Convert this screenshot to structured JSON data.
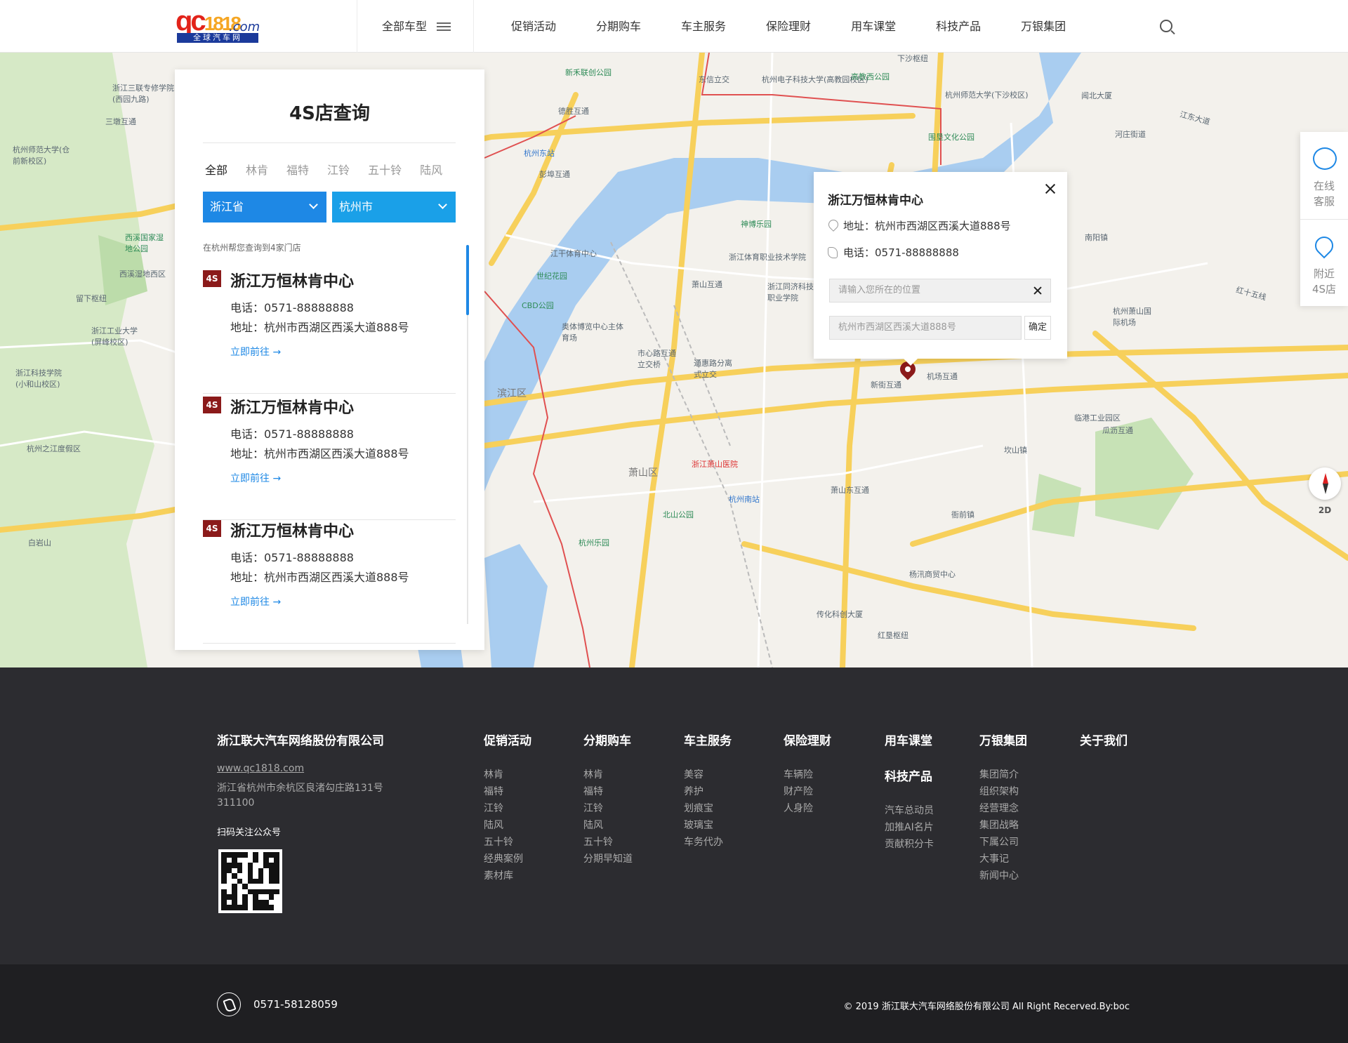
{
  "header": {
    "logo_main": "qc",
    "logo_nums": "1818",
    "logo_com": ".com",
    "logo_sub": "全球汽车网",
    "all_models": "全部车型",
    "nav": [
      "促销活动",
      "分期购车",
      "车主服务",
      "保险理财",
      "用车课堂",
      "科技产品",
      "万银集团"
    ]
  },
  "panel": {
    "title": "4S店查询",
    "brands": [
      "全部",
      "林肯",
      "福特",
      "江铃",
      "五十铃",
      "陆风"
    ],
    "province": "浙江省",
    "city": "杭州市",
    "result_hint": "在杭州帮您查询到4家门店",
    "stores": [
      {
        "badge": "4S",
        "name": "浙江万恒林肯中心",
        "phone": "电话：0571-88888888",
        "address": "地址：杭州市西湖区西溪大道888号",
        "link": "立即前往 →"
      },
      {
        "badge": "4S",
        "name": "浙江万恒林肯中心",
        "phone": "电话：0571-88888888",
        "address": "地址：杭州市西湖区西溪大道888号",
        "link": "立即前往 →"
      },
      {
        "badge": "4S",
        "name": "浙江万恒林肯中心",
        "phone": "电话：0571-88888888",
        "address": "地址：杭州市西湖区西溪大道888号",
        "link": "立即前往 →"
      }
    ]
  },
  "popup": {
    "title": "浙江万恒林肯中心",
    "address": "地址：杭州市西湖区西溪大道888号",
    "phone": "电话：0571-88888888",
    "location_placeholder": "请输入您所在的位置",
    "destination": "杭州市西湖区西溪大道888号",
    "confirm": "确定"
  },
  "side_tools": {
    "service_line1": "在线",
    "service_line2": "客服",
    "nearby_line1": "附近",
    "nearby_line2": "4S店",
    "map_mode": "2D"
  },
  "map_labels": [
    {
      "text": "新禾联创公园",
      "cls": "green"
    },
    {
      "text": "东信立交",
      "cls": ""
    },
    {
      "text": "杭州电子科技大学(高教园校区)",
      "cls": ""
    },
    {
      "text": "高教西公园",
      "cls": "green"
    },
    {
      "text": "杭州师范大学(下沙校区)",
      "cls": ""
    },
    {
      "text": "闻北大厦",
      "cls": ""
    },
    {
      "text": "江东大道",
      "cls": ""
    },
    {
      "text": "德胜互通",
      "cls": ""
    },
    {
      "text": "围垦文化公园",
      "cls": "green"
    },
    {
      "text": "杭州东站",
      "cls": "blue"
    },
    {
      "text": "彭埠互通",
      "cls": ""
    },
    {
      "text": "神博乐园",
      "cls": "green"
    },
    {
      "text": "浙江体育职业技术学院",
      "cls": ""
    },
    {
      "text": "江干体育中心",
      "cls": ""
    },
    {
      "text": "世纪花园",
      "cls": "green"
    },
    {
      "text": "CBD公园",
      "cls": "green"
    },
    {
      "text": "萧山互通",
      "cls": ""
    },
    {
      "text": "浙江同济科技职业学院",
      "cls": ""
    },
    {
      "text": "奥体博览中心主体育场",
      "cls": ""
    },
    {
      "text": "市心路互通立交桥",
      "cls": ""
    },
    {
      "text": "通惠路分离式立交",
      "cls": ""
    },
    {
      "text": "滨江区",
      "cls": "big"
    },
    {
      "text": "新街互通",
      "cls": ""
    },
    {
      "text": "机场互通",
      "cls": ""
    },
    {
      "text": "杭州萧山国际机场",
      "cls": ""
    },
    {
      "text": "红十五线",
      "cls": ""
    },
    {
      "text": "临港工业园区",
      "cls": ""
    },
    {
      "text": "瓜沥互通",
      "cls": ""
    },
    {
      "text": "浙江萧山医院",
      "cls": ""
    },
    {
      "text": "萧山区",
      "cls": "big"
    },
    {
      "text": "杭州南站",
      "cls": "blue"
    },
    {
      "text": "北山公园",
      "cls": "green"
    },
    {
      "text": "萧山东互通",
      "cls": ""
    },
    {
      "text": "坎山镇",
      "cls": ""
    },
    {
      "text": "衙前镇",
      "cls": ""
    },
    {
      "text": "杭州乐园",
      "cls": "green"
    },
    {
      "text": "杨汛商贸中心",
      "cls": ""
    },
    {
      "text": "传化科创大厦",
      "cls": ""
    },
    {
      "text": "红垦枢纽",
      "cls": ""
    },
    {
      "text": "三墩互通",
      "cls": ""
    },
    {
      "text": "浙江三联专修学院(西园九路)",
      "cls": ""
    },
    {
      "text": "杭州师范大学(仓前新校区)",
      "cls": ""
    },
    {
      "text": "西溪国家湿地公园",
      "cls": "green"
    },
    {
      "text": "西溪湿地西区",
      "cls": ""
    },
    {
      "text": "留下枢纽",
      "cls": ""
    },
    {
      "text": "浙江工业大学(屏峰校区)",
      "cls": ""
    },
    {
      "text": "浙江科技学院(小和山校区)",
      "cls": ""
    },
    {
      "text": "杭州之江度假区",
      "cls": ""
    },
    {
      "text": "白岩山",
      "cls": ""
    },
    {
      "text": "南阳镇",
      "cls": ""
    },
    {
      "text": "河庄街道",
      "cls": ""
    },
    {
      "text": "下沙枢纽",
      "cls": ""
    }
  ],
  "footer": {
    "company": "浙江联大汽车网络股份有限公司",
    "url": "www.qc1818.com",
    "address": "浙江省杭州市余杭区良渚勾庄路131号",
    "zip": "311100",
    "qr_label": "扫码关注公众号",
    "columns": [
      {
        "title": "促销活动",
        "items": [
          "林肯",
          "福特",
          "江铃",
          "陆风",
          "五十铃",
          "经典案例",
          "素材库"
        ]
      },
      {
        "title": "分期购车",
        "items": [
          "林肯",
          "福特",
          "江铃",
          "陆风",
          "五十铃",
          "分期早知道"
        ]
      },
      {
        "title": "车主服务",
        "items": [
          "美容",
          "养护",
          "划痕宝",
          "玻璃宝",
          "车务代办"
        ]
      },
      {
        "title": "保险理财",
        "items": [
          "车辆险",
          "财产险",
          "人身险"
        ]
      },
      {
        "title": "用车课堂",
        "items": [],
        "title2": "科技产品",
        "items2": [
          "汽车总动员",
          "加推AI名片",
          "贡献积分卡"
        ]
      },
      {
        "title": "万银集团",
        "items": [
          "集团简介",
          "组织架构",
          "经营理念",
          "集团战略",
          "下属公司",
          "大事记",
          "新闻中心"
        ]
      },
      {
        "title": "关于我们",
        "items": []
      }
    ],
    "hotline": "0571-58128059",
    "copyright": "© 2019 浙江联大汽车网络股份有限公司 All Right Recerved.By:boc"
  }
}
